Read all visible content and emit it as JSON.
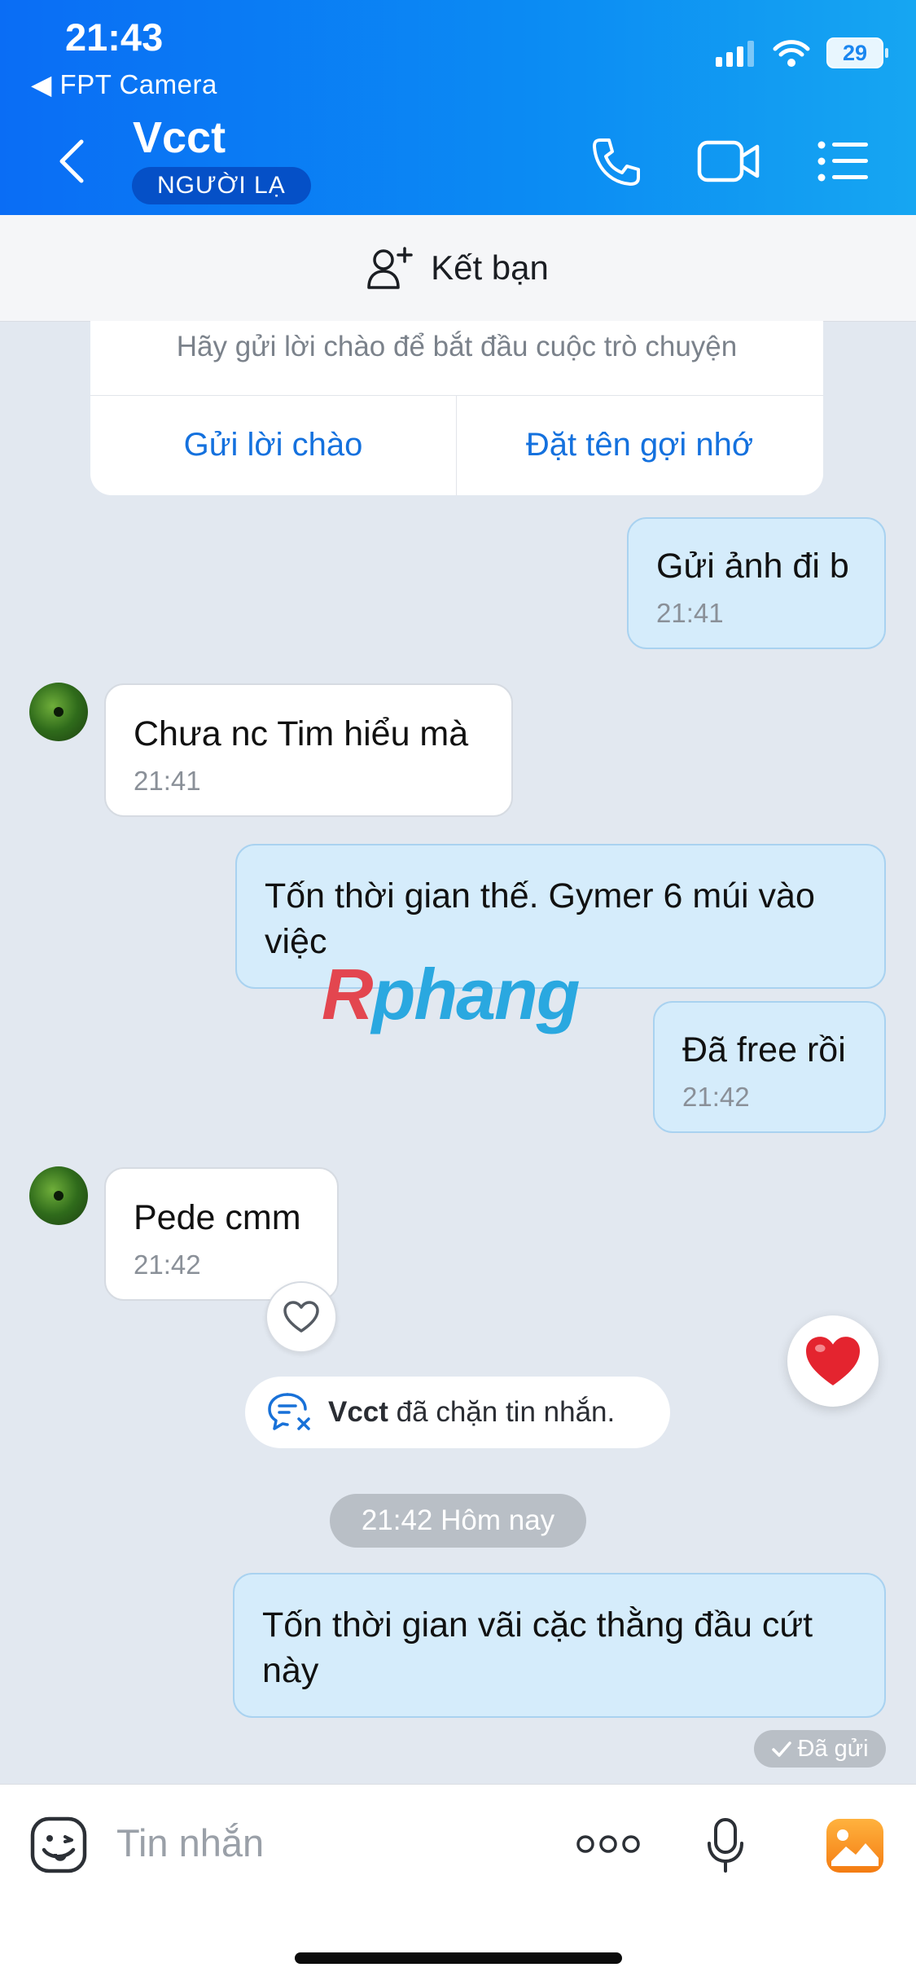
{
  "status_bar": {
    "time": "21:43",
    "back_app": "◀ FPT Camera",
    "battery": "29"
  },
  "header": {
    "name": "Vcct",
    "badge": "NGƯỜI LẠ"
  },
  "friend_bar": {
    "label": "Kết bạn"
  },
  "greeting_card": {
    "hint": "Hãy gửi lời chào để bắt đầu cuộc trò chuyện",
    "greet_button": "Gửi lời chào",
    "nickname_button": "Đặt tên gợi nhớ"
  },
  "messages": [
    {
      "direction": "out",
      "text": "Gửi ảnh đi b",
      "time": "21:41"
    },
    {
      "direction": "in",
      "text": "Chưa nc Tim hiểu mà",
      "time": "21:41"
    },
    {
      "direction": "out",
      "text": "Tốn thời gian thế. Gymer 6 múi vào việc",
      "time": ""
    },
    {
      "direction": "out",
      "text": "Đã free rồi",
      "time": "21:42"
    },
    {
      "direction": "in",
      "text": "Pede cmm",
      "time": "21:42"
    },
    {
      "direction": "out",
      "text": "Tốn thời gian vãi cặc thằng đầu cứt này",
      "time": ""
    }
  ],
  "watermark": {
    "first": "R",
    "rest": "phang"
  },
  "blocked_notice": {
    "name": "Vcct",
    "text": "đã chặn tin nhắn."
  },
  "date_separator": "21:42 Hôm nay",
  "sent_status": "Đã gửi",
  "input": {
    "placeholder": "Tin nhắn"
  },
  "colors": {
    "header": "#0b8cf3",
    "out_bubble": "#d5ecfb",
    "accent": "#1471de"
  }
}
